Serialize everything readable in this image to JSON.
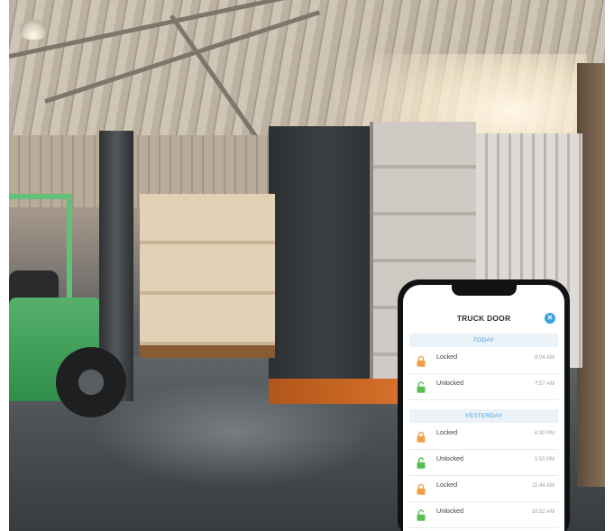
{
  "phone": {
    "app_title": "TRUCK DOOR",
    "close_icon": "close-icon",
    "sections": [
      {
        "header": "TODAY",
        "events": [
          {
            "status": "Locked",
            "time": "8:04 AM",
            "icon": "lock-closed-icon",
            "color": "#f0a04b"
          },
          {
            "status": "Unlocked",
            "time": "7:57 AM",
            "icon": "lock-open-icon",
            "color": "#5bbd5a"
          }
        ]
      },
      {
        "header": "YESTERDAY",
        "events": [
          {
            "status": "Locked",
            "time": "4:30 PM",
            "icon": "lock-closed-icon",
            "color": "#f0a04b"
          },
          {
            "status": "Unlocked",
            "time": "3:50 PM",
            "icon": "lock-open-icon",
            "color": "#5bbd5a"
          },
          {
            "status": "Locked",
            "time": "11:44 AM",
            "icon": "lock-closed-icon",
            "color": "#f0a04b"
          },
          {
            "status": "Unlocked",
            "time": "10:52 AM",
            "icon": "lock-open-icon",
            "color": "#5bbd5a"
          }
        ]
      }
    ],
    "accent_color": "#38a3df"
  }
}
